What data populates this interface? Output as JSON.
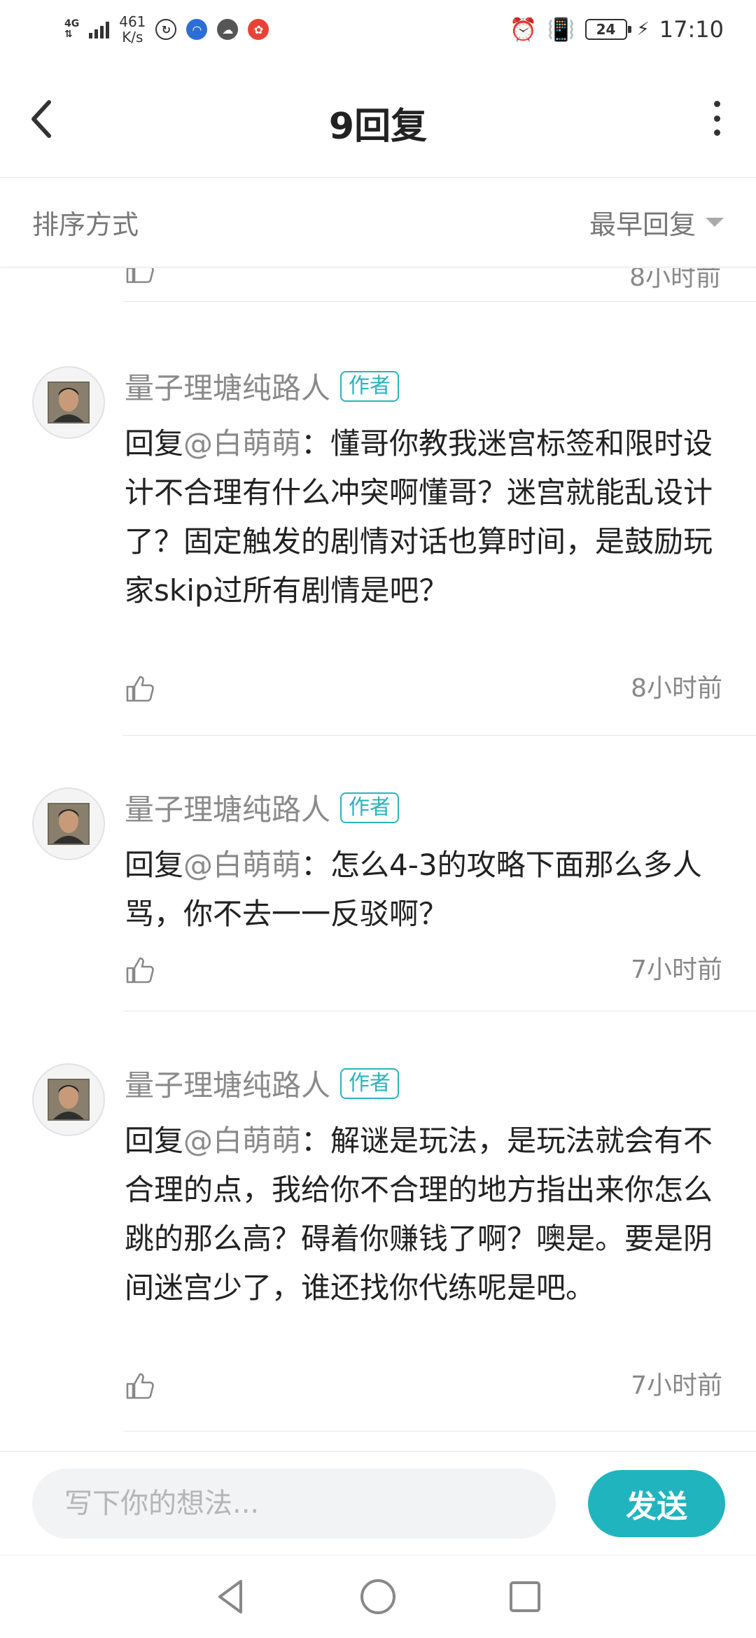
{
  "status_bar": {
    "network": "4G",
    "speed_value": "461",
    "speed_unit": "K/s",
    "battery": "24",
    "time": "17:10"
  },
  "header": {
    "title": "9回复"
  },
  "sort": {
    "label": "排序方式",
    "selected": "最早回复"
  },
  "partial_comment": {
    "time": "8小时前"
  },
  "comments": [
    {
      "author": "量子理塘纯路人",
      "badge": "作者",
      "reply_prefix": "回复",
      "mention": "@白萌萌",
      "separator": "：",
      "text": "懂哥你教我迷宫标签和限时设计不合理有什么冲突啊懂哥？迷宫就能乱设计了？固定触发的剧情对话也算时间，是鼓励玩家skip过所有剧情是吧？",
      "time": "8小时前"
    },
    {
      "author": "量子理塘纯路人",
      "badge": "作者",
      "reply_prefix": "回复",
      "mention": "@白萌萌",
      "separator": "：",
      "text": "怎么4-3的攻略下面那么多人骂，你不去一一反驳啊？",
      "time": "7小时前"
    },
    {
      "author": "量子理塘纯路人",
      "badge": "作者",
      "reply_prefix": "回复",
      "mention": "@白萌萌",
      "separator": "：",
      "text": "解谜是玩法，是玩法就会有不合理的点，我给你不合理的地方指出来你怎么跳的那么高？碍着你赚钱了啊？噢是。要是阴间迷宫少了，谁还找你代练呢是吧。",
      "time": "7小时前"
    }
  ],
  "composer": {
    "placeholder": "写下你的想法...",
    "send_label": "发送"
  },
  "colors": {
    "accent": "#20b4bf",
    "badge": "#2bb3bd",
    "muted_text": "#8a8a8a",
    "divider": "#e6e6e6"
  }
}
